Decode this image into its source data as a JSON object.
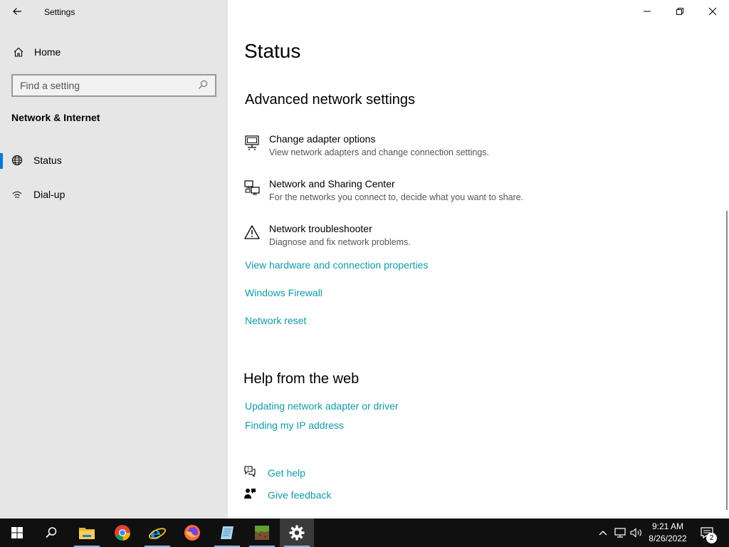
{
  "window": {
    "app_title": "Settings",
    "controls": {
      "minimize": "minimize-icon",
      "restore": "restore-icon",
      "close": "close-icon"
    }
  },
  "sidebar": {
    "home_label": "Home",
    "search_placeholder": "Find a setting",
    "section_header": "Network & Internet",
    "items": [
      {
        "label": "Status",
        "icon": "globe-icon",
        "selected": true
      },
      {
        "label": "Dial-up",
        "icon": "dialup-icon",
        "selected": false
      }
    ]
  },
  "main": {
    "page_title": "Status",
    "advanced": {
      "heading": "Advanced network settings",
      "items": [
        {
          "title": "Change adapter options",
          "desc": "View network adapters and change connection settings.",
          "icon": "adapter-icon"
        },
        {
          "title": "Network and Sharing Center",
          "desc": "For the networks you connect to, decide what you want to share.",
          "icon": "sharing-center-icon"
        },
        {
          "title": "Network troubleshooter",
          "desc": "Diagnose and fix network problems.",
          "icon": "warning-icon"
        }
      ],
      "links": [
        "View hardware and connection properties",
        "Windows Firewall",
        "Network reset"
      ]
    },
    "help": {
      "heading": "Help from the web",
      "links": [
        "Updating network adapter or driver",
        "Finding my IP address"
      ]
    },
    "footer_links": {
      "get_help": "Get help",
      "give_feedback": "Give feedback"
    }
  },
  "taskbar": {
    "apps": [
      "start-icon",
      "search-icon",
      "file-explorer-icon",
      "chrome-icon",
      "edge-icon",
      "firefox-icon",
      "notepad-icon",
      "minecraft-icon",
      "settings-icon"
    ],
    "time": "9:21 AM",
    "date": "8/26/2022",
    "notification_count": "2"
  },
  "colors": {
    "accent": "#0078d7",
    "link": "#0f9aa8",
    "sidebar_bg": "#e6e6e6",
    "taskbar_bg": "#101010"
  }
}
